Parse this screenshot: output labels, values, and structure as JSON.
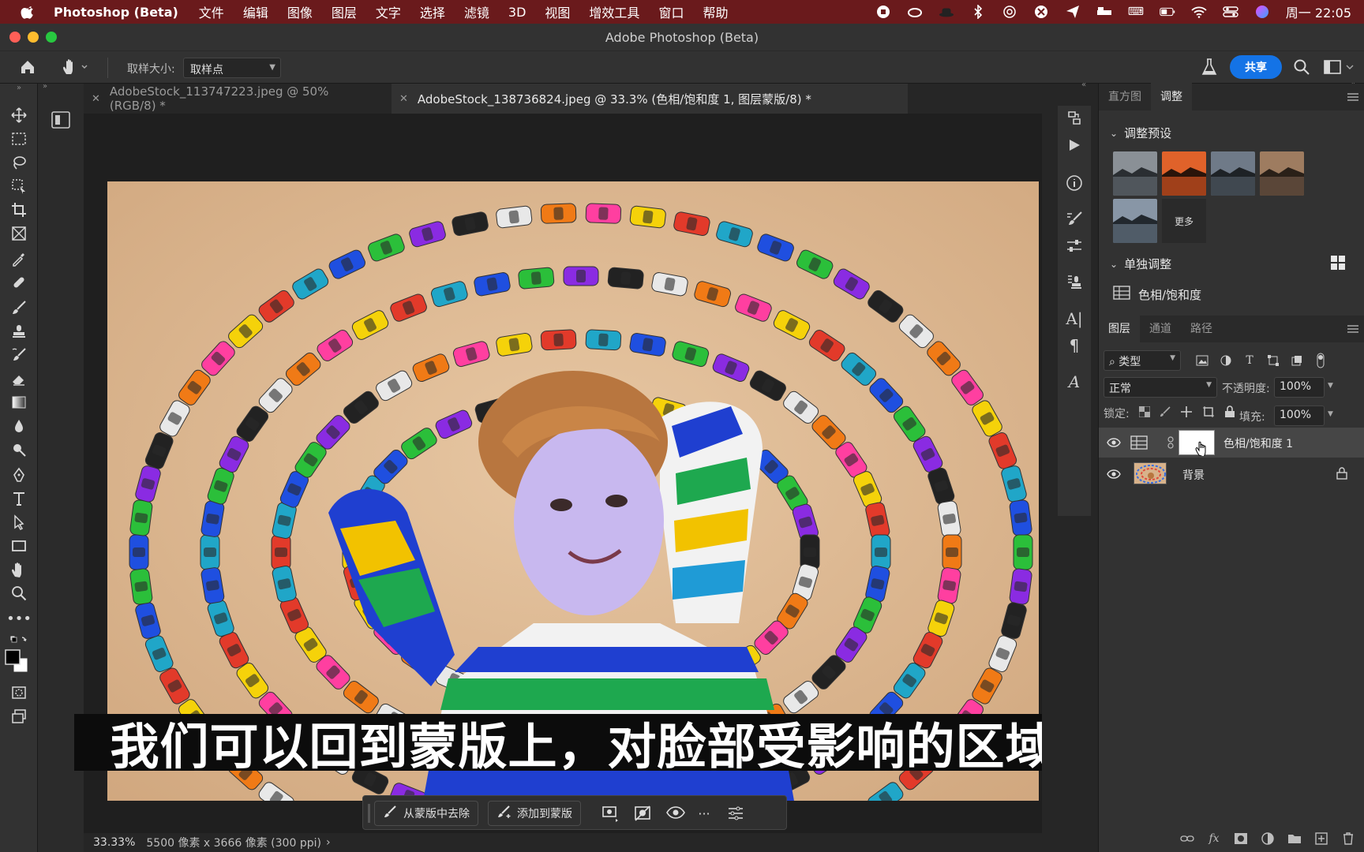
{
  "menubar": {
    "app_name": "Photoshop (Beta)",
    "items": [
      "文件",
      "编辑",
      "图像",
      "图层",
      "文字",
      "选择",
      "滤镜",
      "3D",
      "视图",
      "增效工具",
      "窗口",
      "帮助"
    ],
    "clock": "周一 22:05"
  },
  "window": {
    "title": "Adobe Photoshop (Beta)"
  },
  "options": {
    "sample_size_label": "取样大小:",
    "sample_size_value": "取样点",
    "share_label": "共享"
  },
  "tabs": [
    {
      "label": "AdobeStock_113747223.jpeg @ 50%(RGB/8) *",
      "active": false
    },
    {
      "label": "AdobeStock_138736824.jpeg @ 33.3% (色相/饱和度 1, 图层蒙版/8) *",
      "active": true
    }
  ],
  "subtitle": "我们可以回到蒙版上，对脸部受影响的区域进行蒙版",
  "taskbar": {
    "subtract_label": "从蒙版中去除",
    "add_label": "添加到蒙版",
    "more": "···"
  },
  "status": {
    "zoom": "33.33%",
    "doc_info": "5500 像素 x 3666 像素 (300 ppi)",
    "arrow": "›"
  },
  "adjust_panel": {
    "tabs": [
      "直方图",
      "调整"
    ],
    "presets_heading": "调整预设",
    "more_label": "更多",
    "single_heading": "单独调整",
    "hue_sat_label": "色相/饱和度"
  },
  "layers_panel": {
    "tabs": [
      "图层",
      "通道",
      "路径"
    ],
    "filter_label": "类型",
    "blend_mode": "正常",
    "opacity_label": "不透明度:",
    "opacity_value": "100%",
    "lock_label": "锁定:",
    "fill_label": "填充:",
    "fill_value": "100%",
    "layers": [
      {
        "name": "色相/饱和度 1",
        "selected": true
      },
      {
        "name": "背景",
        "selected": false
      }
    ]
  },
  "colors": {
    "menubar_bg": "#6a1a1c",
    "accent": "#1473e6",
    "panel_bg": "#323232"
  }
}
